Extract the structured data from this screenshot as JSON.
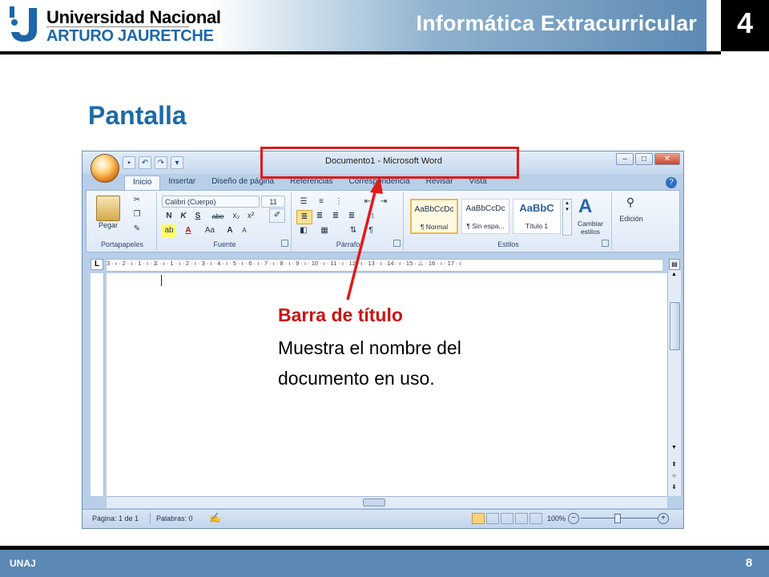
{
  "header": {
    "logo_line1": "Universidad Nacional",
    "logo_line2": "ARTURO JAURETCHE",
    "course_title": "Informática Extracurricular",
    "unit_number": "4"
  },
  "slide": {
    "title": "Pantalla"
  },
  "word_window": {
    "document_title": "Documento1 - Microsoft Word",
    "window_buttons": [
      "–",
      "□",
      "✕"
    ],
    "tabs": [
      "Inicio",
      "Insertar",
      "Diseño de página",
      "Referencias",
      "Correspondencia",
      "Revisar",
      "Vista"
    ],
    "active_tab": "Inicio",
    "ribbon": {
      "portapapeles": {
        "label": "Portapapeles",
        "paste": "Pegar"
      },
      "fuente": {
        "label": "Fuente",
        "font_name": "Calibri (Cuerpo)",
        "font_size": "11",
        "bold": "N",
        "italic": "K",
        "underline": "S",
        "strike": "abe",
        "sub": "x₂",
        "sup": "x²",
        "grow": "A",
        "shrink": "A",
        "case": "Aa"
      },
      "parrafo": {
        "label": "Párrafo",
        "pilcrow": "¶"
      },
      "estilos": {
        "label": "Estilos",
        "items": [
          {
            "preview": "AaBbCcDc",
            "name": "¶ Normal"
          },
          {
            "preview": "AaBbCcDc",
            "name": "¶ Sin espa..."
          },
          {
            "preview": "AaBbC",
            "name": "Título 1"
          }
        ],
        "change_styles": "Cambiar estilos"
      },
      "edicion": {
        "label": "Edición"
      }
    },
    "ruler_marks": "3 · ı · 2 · ı · 1 · ı · ⧖ · ı · 1 · ı · 2 · ı · 3 · ı · 4 · ı · 5 · ı · 6 · ı · 7 · ı · 8 · ı · 9 · ı · 10 · ı · 11 · ı · 12 · ı · 13 · ı · 14 · ı · 15 · △ · 16 · ı · 17 · ı",
    "status": {
      "page": "Página: 1 de 1",
      "words": "Palabras: 0",
      "zoom": "100%"
    }
  },
  "annotation": {
    "title": "Barra de título",
    "desc_line1": "Muestra el nombre del",
    "desc_line2": "documento en uso.",
    "color": "#cc1212"
  },
  "footer": {
    "left": "UNAJ",
    "page_number": "8"
  },
  "colors": {
    "brand_blue": "#1b6aa8",
    "footer_blue": "#5b88b4",
    "highlight_red": "#e01a1a"
  }
}
